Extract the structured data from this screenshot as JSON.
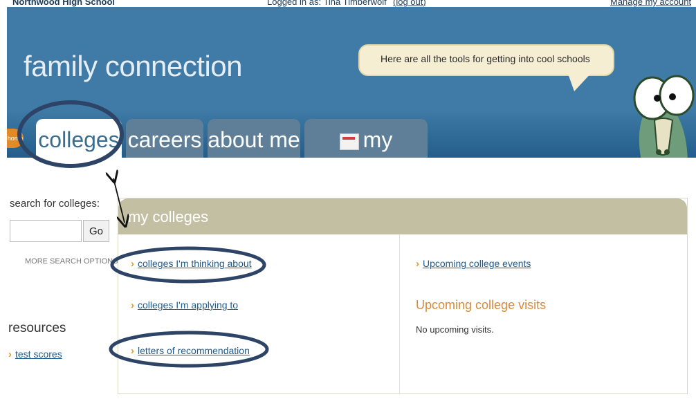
{
  "topbar": {
    "school": "Northwood High School",
    "logged_in": "Logged in as: Tina Timberwolf",
    "logout": "(log out)",
    "manage": "Manage my account"
  },
  "header": {
    "brand": "family connection",
    "bubble_text": "Here are all the tools for getting into cool schools",
    "home_tab": "home",
    "tabs": [
      "colleges",
      "careers",
      "about me",
      "my planner"
    ],
    "colors": {
      "header_blue": "#3f7ba6",
      "tab_gray": "#5f7f98",
      "accent_orange": "#e08a28"
    }
  },
  "sidebar": {
    "search_label": "search for colleges:",
    "search_placeholder": "",
    "go_button": "Go",
    "more_search": "MORE SEARCH OPTIONS >>",
    "resources_heading": "resources",
    "resources_items": [
      "test scores"
    ]
  },
  "panel": {
    "title": "my colleges",
    "left_links": [
      "colleges I'm thinking about",
      "colleges I'm applying to",
      "letters of recommendation"
    ],
    "right_link": "Upcoming college events",
    "visits_heading": "Upcoming college visits",
    "no_visits": "No upcoming visits."
  },
  "icons": {
    "link_bullet": "chevron-right-icon",
    "planner_icon": "calendar-icon",
    "mascot": "cartoon-alligator-mascot"
  }
}
